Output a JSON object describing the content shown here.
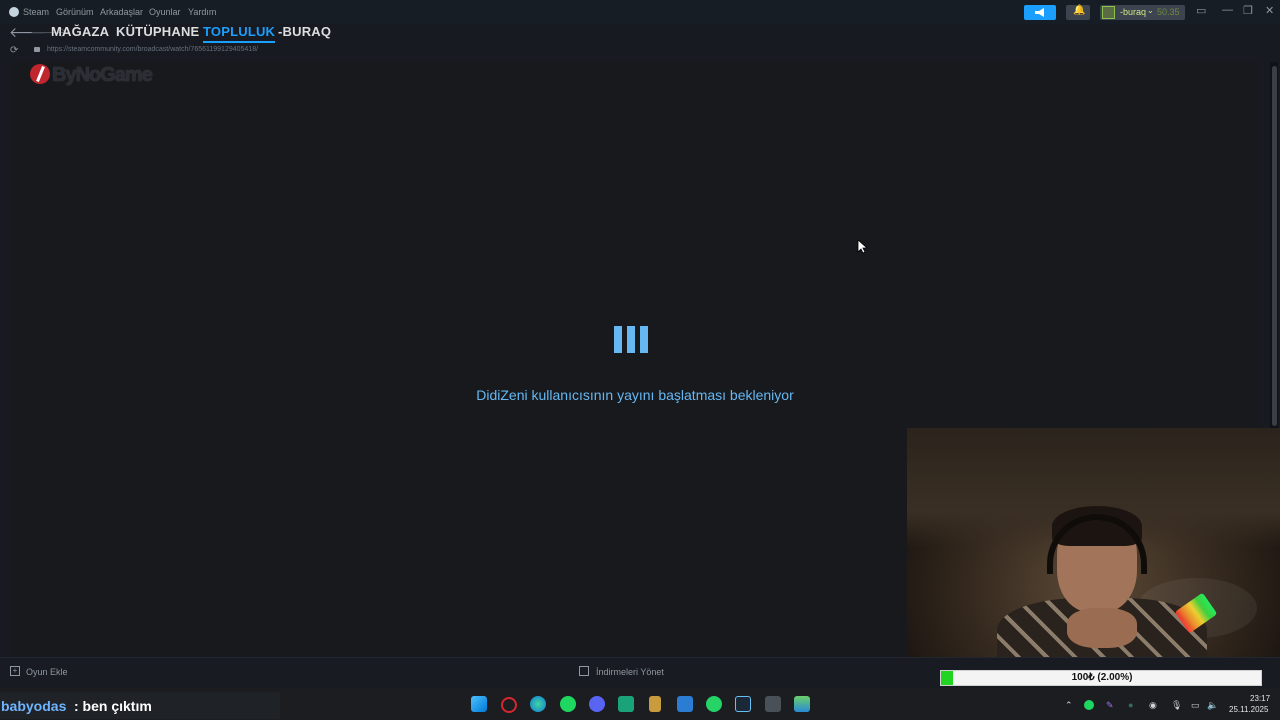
{
  "menubar": {
    "items": [
      "Steam",
      "Görünüm",
      "Arkadaşlar",
      "Oyunlar",
      "Yardım"
    ],
    "user": {
      "name": "-buraq",
      "wallet": "50.35"
    },
    "icons": [
      "steam-logo",
      "megaphone-icon",
      "bell-icon",
      "monitor-icon",
      "minimize-icon",
      "restore-icon",
      "close-icon"
    ]
  },
  "nav": {
    "tabs": [
      "MAĞAZA",
      "KÜTÜPHANE",
      "TOPLULUK",
      "-BURAQ"
    ],
    "active_tab": "TOPLULUK"
  },
  "address": {
    "url": "https://steamcommunity.com/broadcast/watch/76561199129405418/"
  },
  "broadcast": {
    "watermark": "ByNoGame",
    "waiting_text": "DidiZeni kullanıcısının yayını başlatması bekleniyor"
  },
  "bottombar": {
    "add_game": "Oyun Ekle",
    "downloads": "İndirmeleri Yönet"
  },
  "overlay": {
    "progress_label": "100₺ (2.00%)",
    "progress_fraction": 0.02,
    "progress_color": "#22d422"
  },
  "chat": {
    "user": "babyodas",
    "message": ": ben çıktım"
  },
  "taskbar": {
    "icons": [
      "windows-start-icon",
      "opera-icon",
      "edge-icon",
      "spotify-icon",
      "discord-icon",
      "app-icon",
      "league-icon",
      "mail-icon",
      "whatsapp-icon",
      "steam-icon",
      "calculator-icon",
      "photos-icon"
    ],
    "time": "23:17",
    "date": "25.11.2025"
  },
  "colors": {
    "accent": "#1a9fff",
    "loader": "#66b8f3",
    "background": "#171a21"
  }
}
